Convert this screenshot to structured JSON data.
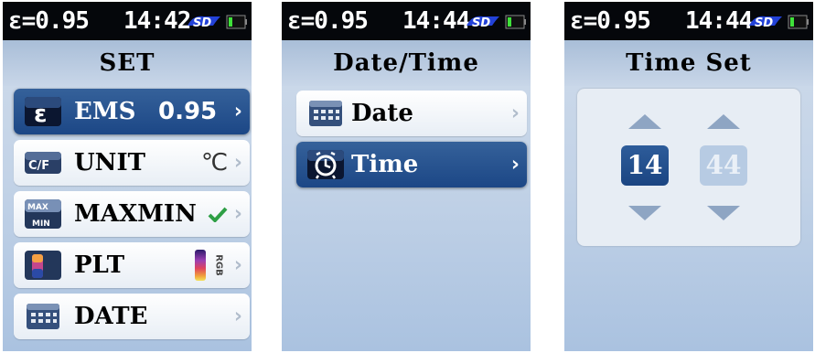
{
  "status": {
    "emissivity": "ε=0.95",
    "screen1_time": "14:42",
    "screen2_time": "14:44",
    "screen3_time": "14:44",
    "sd_icon": "sd-card-icon",
    "battery_icon": "battery-icon"
  },
  "screen1": {
    "title": "SET",
    "items": [
      {
        "icon": "emissivity-icon",
        "label": "EMS",
        "value": "0.95",
        "selected": true
      },
      {
        "icon": "unit-cf-icon",
        "label": "UNIT",
        "value": "℃",
        "selected": false
      },
      {
        "icon": "maxmin-icon",
        "label": "MAXMIN",
        "value": "check-icon",
        "selected": false
      },
      {
        "icon": "palette-icon",
        "label": "PLT",
        "value": "RGB",
        "selected": false
      },
      {
        "icon": "calendar-icon",
        "label": "DATE",
        "value": "",
        "selected": false
      }
    ]
  },
  "screen2": {
    "title": "Date/Time",
    "items": [
      {
        "icon": "calendar-icon",
        "label": "Date",
        "selected": false
      },
      {
        "icon": "alarm-clock-icon",
        "label": "Time",
        "selected": true
      }
    ]
  },
  "screen3": {
    "title": "Time Set",
    "hour": "14",
    "minute": "44"
  },
  "chevron": "›",
  "colors": {
    "selected_row": "#1c4786",
    "status_bar": "#05070b",
    "background": "#c3d3e7",
    "sd_icon": "#2342d8",
    "battery_fill": "#3fe13a"
  }
}
